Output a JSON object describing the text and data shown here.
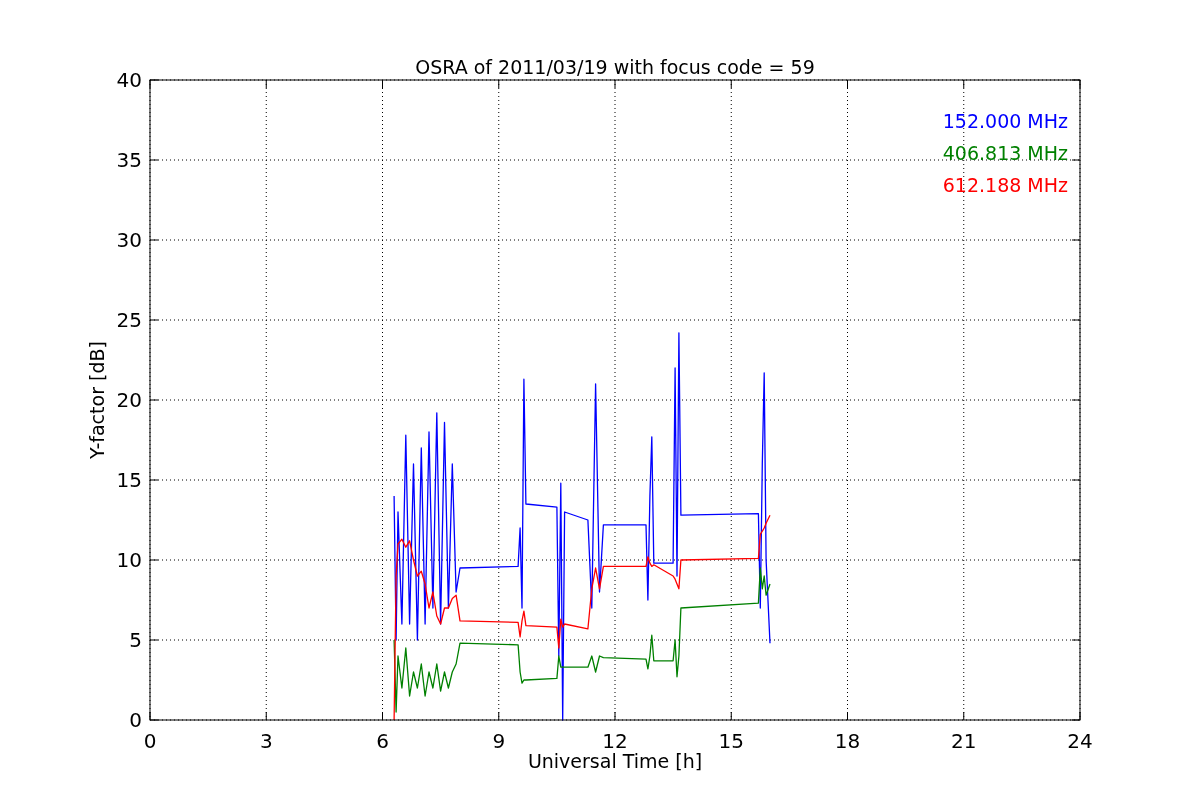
{
  "chart_data": {
    "type": "line",
    "title": "OSRA of 2011/03/19 with focus code = 59",
    "xlabel": "Universal Time [h]",
    "ylabel": "Y-factor [dB]",
    "xlim": [
      0,
      24
    ],
    "ylim": [
      0,
      40
    ],
    "xticks": [
      0,
      3,
      6,
      9,
      12,
      15,
      18,
      21,
      24
    ],
    "yticks": [
      0,
      5,
      10,
      15,
      20,
      25,
      30,
      35,
      40
    ],
    "grid": true,
    "x": [
      6.3,
      6.35,
      6.4,
      6.5,
      6.6,
      6.7,
      6.8,
      6.9,
      7.0,
      7.1,
      7.2,
      7.3,
      7.4,
      7.5,
      7.6,
      7.7,
      7.8,
      7.9,
      8.0,
      9.5,
      9.55,
      9.6,
      9.65,
      9.7,
      10.5,
      10.55,
      10.6,
      10.65,
      10.7,
      11.3,
      11.4,
      11.5,
      11.6,
      11.7,
      12.8,
      12.85,
      12.9,
      12.95,
      13.0,
      13.5,
      13.55,
      13.6,
      13.65,
      13.7,
      15.7,
      15.75,
      15.8,
      15.85,
      15.9,
      16.0
    ],
    "series": [
      {
        "name": "152.000 MHz",
        "color": "#0000ff",
        "values": [
          14,
          5,
          13,
          6,
          17.8,
          6,
          16,
          5,
          17,
          6,
          18,
          7,
          19.2,
          6,
          18.6,
          7,
          16,
          8,
          9.5,
          9.6,
          12,
          7,
          21.3,
          13.5,
          13.3,
          4,
          14.8,
          0,
          13,
          12.5,
          7,
          21,
          8,
          12.2,
          12.2,
          7.5,
          14,
          17.7,
          9.8,
          9.8,
          22,
          9,
          24.2,
          12.8,
          12.9,
          7,
          16,
          21.7,
          10,
          4.8
        ]
      },
      {
        "name": "406.813 MHz",
        "color": "#008000",
        "values": [
          5,
          0.5,
          4,
          2,
          4.5,
          1.5,
          3,
          2,
          3.5,
          1.5,
          3,
          2,
          3.5,
          1.8,
          3,
          2,
          3,
          3.5,
          4.8,
          4.7,
          3,
          2.3,
          2.5,
          2.5,
          2.6,
          4,
          3.3,
          3.3,
          3.3,
          3.3,
          4,
          3,
          4,
          3.9,
          3.8,
          3.2,
          4,
          5.3,
          3.7,
          3.7,
          5,
          2.7,
          4,
          7,
          7.3,
          9.5,
          8.2,
          9,
          7.8,
          8.5
        ]
      },
      {
        "name": "612.188 MHz",
        "color": "#ff0000",
        "values": [
          0,
          9,
          11,
          11.3,
          10.8,
          11.2,
          10,
          9,
          9.3,
          8.5,
          7,
          8,
          6.5,
          6,
          7,
          7,
          7.6,
          7.8,
          6.2,
          6.1,
          5.2,
          6.2,
          6.8,
          5.9,
          5.8,
          4.5,
          6.3,
          5.8,
          6,
          5.7,
          8.2,
          9.5,
          8.2,
          9.6,
          9.6,
          10.2,
          9.8,
          9.6,
          9.7,
          9,
          8.8,
          8.5,
          8.2,
          10,
          10.1,
          11.6,
          11.8,
          12,
          12.3,
          12.8
        ]
      }
    ]
  }
}
